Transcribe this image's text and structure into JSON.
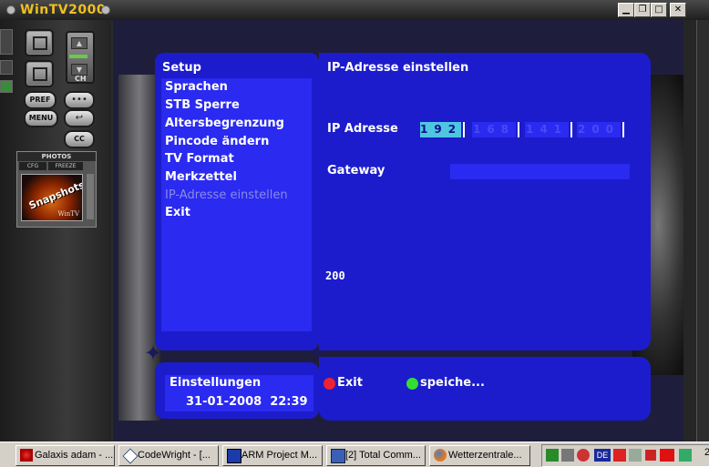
{
  "app": {
    "title": "WinTV2000"
  },
  "window_controls": {
    "minimize": "▁",
    "restore": "❐",
    "maximize": "□",
    "close": "✕"
  },
  "panel": {
    "ch_label": "CH",
    "pref_label": "PREF",
    "menu_label": "MENU",
    "cc_label": "CC",
    "photos": {
      "label": "PHOTOS",
      "cfg_tab": "CFG",
      "freeze_tab": "FREEZE",
      "thumb_text": "Snapshots",
      "thumb_sub": "WinTV"
    }
  },
  "osd": {
    "left_title": "Setup",
    "menu_items": [
      {
        "label": "Sprachen",
        "active": true
      },
      {
        "label": "STB Sperre",
        "active": true
      },
      {
        "label": "Altersbegrenzung",
        "active": true
      },
      {
        "label": "Pincode ändern",
        "active": true
      },
      {
        "label": "TV Format",
        "active": true
      },
      {
        "label": "Merkzettel",
        "active": true
      },
      {
        "label": "IP-Adresse einstellen",
        "active": false
      },
      {
        "label": "Exit",
        "active": true
      }
    ],
    "right_title": "IP-Adresse einstellen",
    "ip_label": "IP Adresse",
    "ip_segments": [
      "192",
      "168",
      "141",
      "200"
    ],
    "gateway_label": "Gateway",
    "counter": "200",
    "bottom_left_title": "Einstellungen",
    "date_time": "31-01-2008  22:39",
    "exit_button": "Exit",
    "save_button": "speiche...",
    "colors": {
      "panel": "#1c1ccc",
      "field": "#2a2af0",
      "focus": "#4ec6e0",
      "red": "#ee2233",
      "green": "#33dd33"
    }
  },
  "taskbar": {
    "buttons": [
      {
        "label": "Galaxis adam - ...",
        "icon": "galaxis-icon"
      },
      {
        "label": "CodeWright - [...",
        "icon": "codewright-icon"
      },
      {
        "label": "ARM Project M...",
        "icon": "arm-project-icon"
      },
      {
        "label": "[2] Total Comm...",
        "icon": "total-commander-icon"
      },
      {
        "label": "Wetterzentrale...",
        "icon": "firefox-icon"
      }
    ],
    "tray_lang": "DE",
    "clock": "2"
  }
}
